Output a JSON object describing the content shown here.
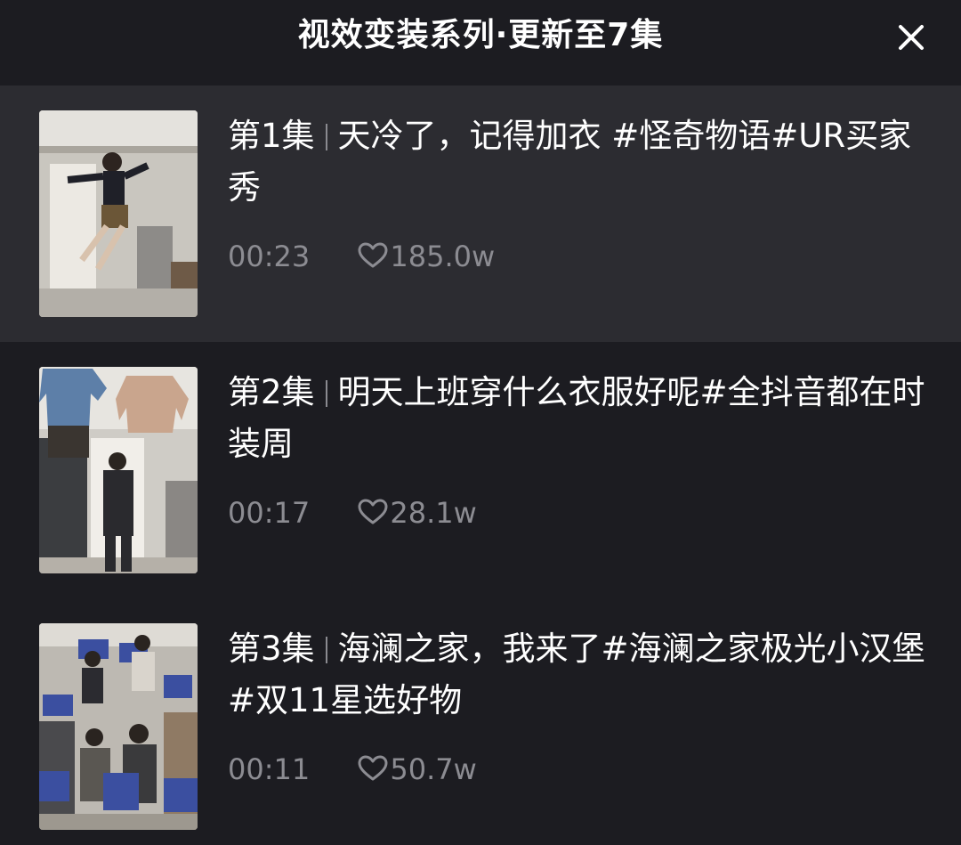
{
  "header": {
    "title": "视效变装系列·更新至7集",
    "close_icon": "close-icon"
  },
  "episodes": [
    {
      "episode_label": "第1集",
      "title": "天冷了，记得加衣 #怪奇物语#UR买家秀",
      "duration": "00:23",
      "likes": "185.0w",
      "active": true
    },
    {
      "episode_label": "第2集",
      "title": "明天上班穿什么衣服好呢#全抖音都在时装周",
      "duration": "00:17",
      "likes": "28.1w",
      "active": false
    },
    {
      "episode_label": "第3集",
      "title": "海澜之家，我来了#海澜之家极光小汉堡 #双11星选好物",
      "duration": "00:11",
      "likes": "50.7w",
      "active": false
    }
  ],
  "colors": {
    "background": "#1c1c21",
    "active_row": "#2c2c31",
    "title_text": "#ffffff",
    "meta_text": "#8c8c92"
  }
}
